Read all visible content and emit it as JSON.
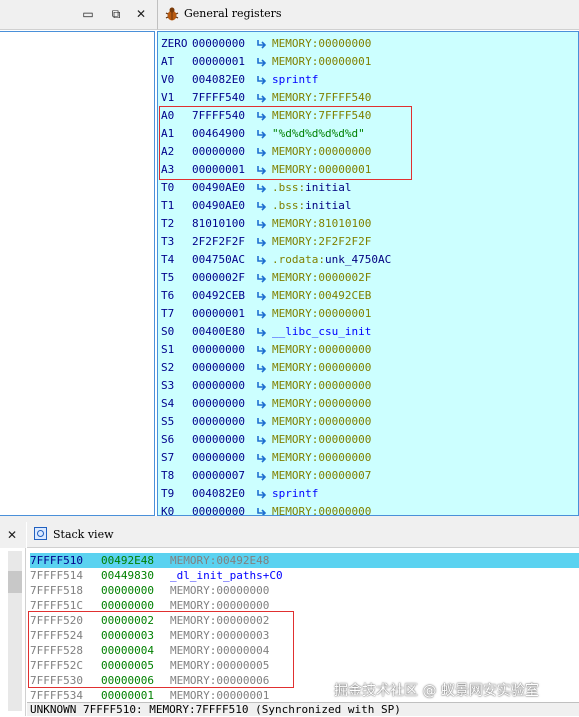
{
  "left_top_panel": {
    "window_buttons": [
      "▭",
      "⧉",
      "✕"
    ]
  },
  "registers_panel": {
    "title": "General registers",
    "rows": [
      {
        "name": "ZERO",
        "value": "00000000",
        "target": "MEMORY:00000000",
        "kind": "mem"
      },
      {
        "name": "AT",
        "value": "00000001",
        "target": "MEMORY:00000001",
        "kind": "mem"
      },
      {
        "name": "V0",
        "value": "004082E0",
        "target": "sprintf",
        "kind": "code"
      },
      {
        "name": "V1",
        "value": "7FFFF540",
        "target": "MEMORY:7FFFF540",
        "kind": "mem"
      },
      {
        "name": "A0",
        "value": "7FFFF540",
        "target": "MEMORY:7FFFF540",
        "kind": "mem"
      },
      {
        "name": "A1",
        "value": "00464900",
        "target": "\"%d%d%d%d%d%d\"",
        "kind": "str"
      },
      {
        "name": "A2",
        "value": "00000000",
        "target": "MEMORY:00000000",
        "kind": "mem"
      },
      {
        "name": "A3",
        "value": "00000001",
        "target": "MEMORY:00000001",
        "kind": "mem"
      },
      {
        "name": "T0",
        "value": "00490AE0",
        "target_seg": ".bss:",
        "target_sym": "initial",
        "kind": "seg"
      },
      {
        "name": "T1",
        "value": "00490AE0",
        "target_seg": ".bss:",
        "target_sym": "initial",
        "kind": "seg"
      },
      {
        "name": "T2",
        "value": "81010100",
        "target": "MEMORY:81010100",
        "kind": "mem"
      },
      {
        "name": "T3",
        "value": "2F2F2F2F",
        "target": "MEMORY:2F2F2F2F",
        "kind": "mem"
      },
      {
        "name": "T4",
        "value": "004750AC",
        "target_seg": ".rodata:",
        "target_sym": "unk_4750AC",
        "kind": "seg"
      },
      {
        "name": "T5",
        "value": "0000002F",
        "target": "MEMORY:0000002F",
        "kind": "mem"
      },
      {
        "name": "T6",
        "value": "00492CEB",
        "target": "MEMORY:00492CEB",
        "kind": "mem"
      },
      {
        "name": "T7",
        "value": "00000001",
        "target": "MEMORY:00000001",
        "kind": "mem"
      },
      {
        "name": "S0",
        "value": "00400E80",
        "target": "__libc_csu_init",
        "kind": "code"
      },
      {
        "name": "S1",
        "value": "00000000",
        "target": "MEMORY:00000000",
        "kind": "mem"
      },
      {
        "name": "S2",
        "value": "00000000",
        "target": "MEMORY:00000000",
        "kind": "mem"
      },
      {
        "name": "S3",
        "value": "00000000",
        "target": "MEMORY:00000000",
        "kind": "mem"
      },
      {
        "name": "S4",
        "value": "00000000",
        "target": "MEMORY:00000000",
        "kind": "mem"
      },
      {
        "name": "S5",
        "value": "00000000",
        "target": "MEMORY:00000000",
        "kind": "mem"
      },
      {
        "name": "S6",
        "value": "00000000",
        "target": "MEMORY:00000000",
        "kind": "mem"
      },
      {
        "name": "S7",
        "value": "00000000",
        "target": "MEMORY:00000000",
        "kind": "mem"
      },
      {
        "name": "T8",
        "value": "00000007",
        "target": "MEMORY:00000007",
        "kind": "mem"
      },
      {
        "name": "T9",
        "value": "004082E0",
        "target": "sprintf",
        "kind": "code"
      },
      {
        "name": "K0",
        "value": "00000000",
        "target": "MEMORY:00000000",
        "kind": "mem"
      }
    ]
  },
  "bottom_left_panel": {
    "close_glyph": "✕"
  },
  "stack_view": {
    "title": "Stack view",
    "rows": [
      {
        "addr": "7FFFF510",
        "value": "00492E48",
        "target": "MEMORY:00492E48",
        "kind": "mem",
        "selected": true
      },
      {
        "addr": "7FFFF514",
        "value": "00449830",
        "target": "_dl_init_paths+C0",
        "kind": "code"
      },
      {
        "addr": "7FFFF518",
        "value": "00000000",
        "target": "MEMORY:00000000",
        "kind": "mem"
      },
      {
        "addr": "7FFFF51C",
        "value": "00000000",
        "target": "MEMORY:00000000",
        "kind": "mem"
      },
      {
        "addr": "7FFFF520",
        "value": "00000002",
        "target": "MEMORY:00000002",
        "kind": "mem"
      },
      {
        "addr": "7FFFF524",
        "value": "00000003",
        "target": "MEMORY:00000003",
        "kind": "mem"
      },
      {
        "addr": "7FFFF528",
        "value": "00000004",
        "target": "MEMORY:00000004",
        "kind": "mem"
      },
      {
        "addr": "7FFFF52C",
        "value": "00000005",
        "target": "MEMORY:00000005",
        "kind": "mem"
      },
      {
        "addr": "7FFFF530",
        "value": "00000006",
        "target": "MEMORY:00000006",
        "kind": "mem"
      },
      {
        "addr": "7FFFF534",
        "value": "00000001",
        "target": "MEMORY:00000001",
        "kind": "mem"
      }
    ],
    "status": "UNKNOWN 7FFFF510: MEMORY:7FFFF510 (Synchronized with SP)"
  },
  "watermark": "掘金技术社区 @ 蚁景网安实验室",
  "colors": {
    "register_bg": "#ccffff",
    "highlight_box": "#e03030",
    "stack_selected": "#5bd2f0"
  }
}
